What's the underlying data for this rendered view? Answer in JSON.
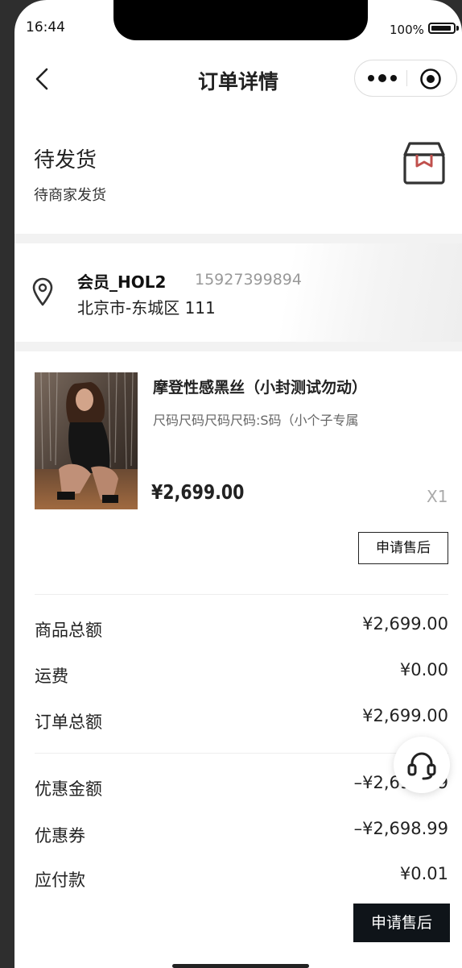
{
  "status_bar": {
    "time": "16:44",
    "battery": "100%"
  },
  "nav": {
    "title": "订单详情"
  },
  "order": {
    "status": "待发货",
    "status_desc": "待商家发货"
  },
  "address": {
    "name": "会员_HOL2",
    "phone": "15927399894",
    "detail": "北京市-东城区 111"
  },
  "product": {
    "name": "摩登性感黑丝（小封测试勿动）",
    "spec": "尺码尺码尺码尺码:S码（小个子专属",
    "price": "¥2,699.00",
    "quantity": "X1",
    "after_sale_label": "申请售后"
  },
  "summary": {
    "goods_total_label": "商品总额",
    "goods_total_value": "¥2,699.00",
    "shipping_label": "运费",
    "shipping_value": "¥0.00",
    "order_total_label": "订单总额",
    "order_total_value": "¥2,699.00",
    "discount_label": "优惠金额",
    "discount_value": "–¥2,698.99",
    "coupon_label": "优惠券",
    "coupon_value": "–¥2,698.99",
    "payable_label": "应付款",
    "payable_value": "¥0.01"
  },
  "footer": {
    "after_sale_label": "申请售后"
  },
  "icons": {
    "back": "chevron-left-icon",
    "more": "more-dots-icon",
    "close": "target-circle-icon",
    "box": "package-box-icon",
    "location": "location-pin-icon",
    "customer_service": "headset-icon"
  },
  "colors": {
    "primary_button": "#0f1419",
    "box_accent": "#c0504d"
  }
}
